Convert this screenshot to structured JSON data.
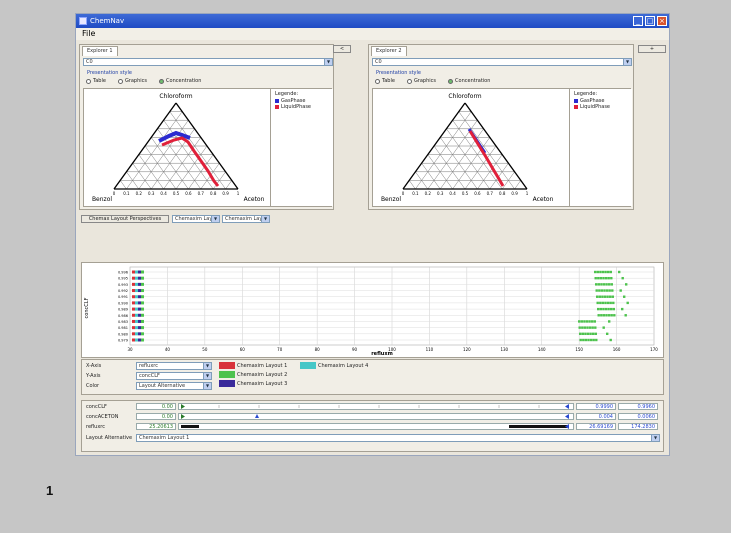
{
  "window": {
    "title": "ChemNav"
  },
  "menu": {
    "file": "File"
  },
  "explorers": [
    {
      "tab": "Explorer 1",
      "selector": "C0",
      "group": "Presentation style",
      "options": [
        "Table",
        "Graphics",
        "Concentration"
      ],
      "selected": "Concentration",
      "ternary": {
        "top": "Chloroform",
        "left": "Benzol",
        "right": "Aceton"
      },
      "legend": {
        "title": "Legende:",
        "items": [
          {
            "label": "GasPhase",
            "color": "#2b2bd0"
          },
          {
            "label": "LiquidPhase",
            "color": "#e0203a"
          }
        ]
      },
      "button": "<"
    },
    {
      "tab": "Explorer 2",
      "selector": "C0",
      "group": "Presentation style",
      "options": [
        "Table",
        "Graphics",
        "Concentration"
      ],
      "selected": "Concentration",
      "ternary": {
        "top": "Chloroform",
        "left": "Benzol",
        "right": "Aceton"
      },
      "legend": {
        "title": "Legende:",
        "items": [
          {
            "label": "GasPhase",
            "color": "#2b2bd0"
          },
          {
            "label": "LiquidPhase",
            "color": "#e0203a"
          }
        ]
      },
      "button": "+"
    }
  ],
  "toolbar": {
    "perspective_button": "Chemax Layout Perspectives",
    "combo1": "Chemaxim Lay",
    "combo2": "Chemaxim Lay"
  },
  "scatter": {
    "ylabel": "concCLF",
    "xlabel": "refluxm",
    "xticks": [
      "30",
      "40",
      "50",
      "60",
      "70",
      "80",
      "90",
      "100",
      "110",
      "120",
      "130",
      "140",
      "150",
      "160",
      "170"
    ],
    "yticks": [
      "0.996",
      "0.995",
      "0.993",
      "0.992",
      "0.991",
      "0.990",
      "0.989",
      "0.986",
      "0.983",
      "0.981",
      "0.980",
      "0.979"
    ]
  },
  "axes_control": {
    "x_label": "X-Axis",
    "x_value": "refluxrc",
    "y_label": "Y-Axis",
    "y_value": "concCLF",
    "color_label": "Color",
    "color_value": "Layout Alternative",
    "layouts": [
      {
        "label": "Chemaxim Layout 1",
        "color": "#d8323a"
      },
      {
        "label": "Chemaxim Layout 2",
        "color": "#4dc24d"
      },
      {
        "label": "Chemaxim Layout 3",
        "color": "#3a2a9a"
      },
      {
        "label": "Chemaxim Layout 4",
        "color": "#45c7c7"
      }
    ]
  },
  "sliders": [
    {
      "label": "concCLF",
      "min": "0.00",
      "max_a": "0.9990",
      "max_b": "0.9960"
    },
    {
      "label": "concACETON",
      "min": "0.00",
      "max_a": "0.004",
      "max_b": "0.0060"
    },
    {
      "label": "refluxrc",
      "min": "25.20613",
      "max_a": "26.69169",
      "max_b": "174.2830"
    }
  ],
  "layout_alt": {
    "label": "Layout Alternative",
    "value": "Chemaxim Layout 1"
  },
  "figure_caption": "1"
}
